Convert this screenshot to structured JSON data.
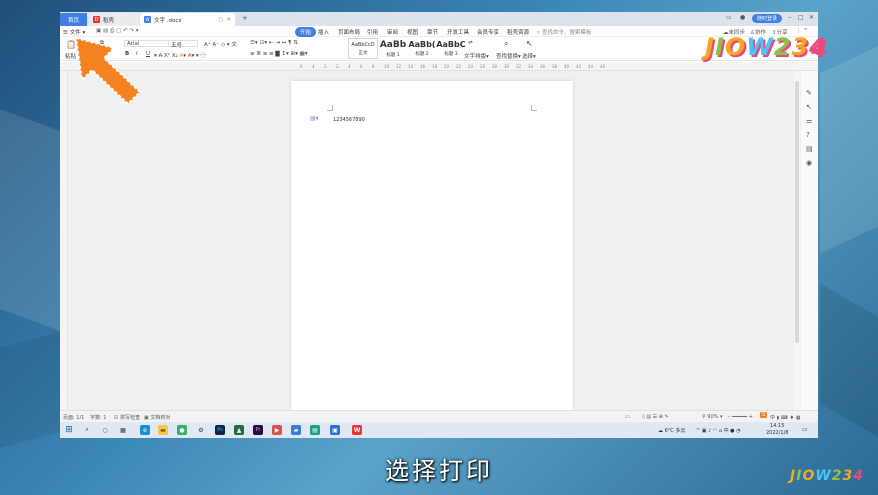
{
  "titlebar": {
    "home_tab": "首页",
    "shell_tab": "稻壳",
    "doc_tab": "文字 .docx",
    "new_tab": "+",
    "login": "随时登录"
  },
  "menu": {
    "file": "文件",
    "items": [
      "开始",
      "插入",
      "页面布局",
      "引用",
      "审阅",
      "视图",
      "章节",
      "开发工具",
      "会员专享",
      "稻壳资源"
    ],
    "search": "查找命令、搜索模板",
    "unsynced": "未同步",
    "collab": "协作",
    "share": "分享"
  },
  "ribbon": {
    "paste": "粘贴",
    "font": "Arial",
    "size": "五号",
    "bold": "B",
    "italic": "I",
    "underline": "U",
    "styles": [
      {
        "preview": "AaBbCcD",
        "name": "正文"
      },
      {
        "preview": "AaBb",
        "name": "标题 1"
      },
      {
        "preview": "AaBb(",
        "name": "标题 2"
      },
      {
        "preview": "AaBbC",
        "name": "标题 3"
      }
    ],
    "text_layout": "文字排版",
    "find_replace": "查找替换",
    "select": "选择"
  },
  "ruler": {
    "numbers": [
      "6",
      "4",
      "2",
      "2",
      "4",
      "6",
      "8",
      "10",
      "12",
      "14",
      "16",
      "18",
      "20",
      "22",
      "24",
      "26",
      "28",
      "30",
      "32",
      "34",
      "36",
      "38",
      "40",
      "42",
      "44",
      "46"
    ]
  },
  "document": {
    "content": "1234567890"
  },
  "status": {
    "page": "页面: 1/1",
    "words": "字数: 1",
    "spellcheck": "拼写检查",
    "proofread": "文档校对",
    "zoom": "90%"
  },
  "taskbar": {
    "weather": "6°C 多云",
    "time": "14:15",
    "date": "2022/1/8"
  },
  "watermark": {
    "brand": "JIOW234"
  },
  "caption": "选择打印",
  "colors": {
    "accent": "#3f7fe6",
    "arrow": "#f58220"
  }
}
